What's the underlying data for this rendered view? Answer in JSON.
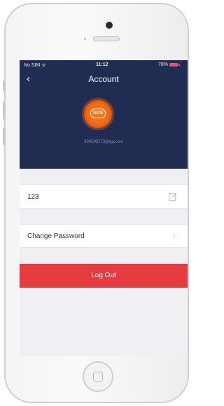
{
  "status_bar": {
    "carrier": "No SIM ᯤ",
    "time": "11:12",
    "battery_percent": "78%"
  },
  "nav": {
    "back_icon": "‹",
    "title": "Account"
  },
  "profile": {
    "avatar_text": "SOS",
    "email": "309285273@qq.com"
  },
  "rows": {
    "username": "123",
    "change_password": "Change Password",
    "chevron": "›"
  },
  "actions": {
    "logout_label": "Log Out"
  },
  "colors": {
    "header_bg": "#212c52",
    "logout_bg": "#e63c3e",
    "avatar_accent": "#f26a11",
    "battery": "#e8517b"
  },
  "icons": {
    "back": "chevron-left-icon",
    "edit": "edit-icon",
    "row_chevron": "chevron-right-icon",
    "home": "home-button-icon"
  }
}
